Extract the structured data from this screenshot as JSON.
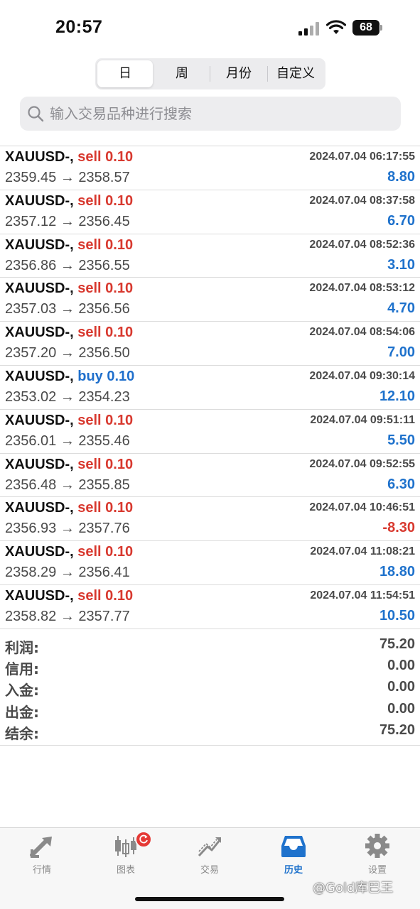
{
  "status_bar": {
    "time": "20:57",
    "battery": "68"
  },
  "period_tabs": [
    "日",
    "周",
    "月份",
    "自定义"
  ],
  "search": {
    "placeholder": "输入交易品种进行搜索"
  },
  "trades": [
    {
      "symbol": "XAUUSD-,",
      "side": "sell",
      "volume": "0.10",
      "time": "2024.07.04 06:17:55",
      "open": "2359.45",
      "close": "2358.57",
      "profit": "8.80"
    },
    {
      "symbol": "XAUUSD-,",
      "side": "sell",
      "volume": "0.10",
      "time": "2024.07.04 08:37:58",
      "open": "2357.12",
      "close": "2356.45",
      "profit": "6.70"
    },
    {
      "symbol": "XAUUSD-,",
      "side": "sell",
      "volume": "0.10",
      "time": "2024.07.04 08:52:36",
      "open": "2356.86",
      "close": "2356.55",
      "profit": "3.10"
    },
    {
      "symbol": "XAUUSD-,",
      "side": "sell",
      "volume": "0.10",
      "time": "2024.07.04 08:53:12",
      "open": "2357.03",
      "close": "2356.56",
      "profit": "4.70"
    },
    {
      "symbol": "XAUUSD-,",
      "side": "sell",
      "volume": "0.10",
      "time": "2024.07.04 08:54:06",
      "open": "2357.20",
      "close": "2356.50",
      "profit": "7.00"
    },
    {
      "symbol": "XAUUSD-,",
      "side": "buy",
      "volume": "0.10",
      "time": "2024.07.04 09:30:14",
      "open": "2353.02",
      "close": "2354.23",
      "profit": "12.10"
    },
    {
      "symbol": "XAUUSD-,",
      "side": "sell",
      "volume": "0.10",
      "time": "2024.07.04 09:51:11",
      "open": "2356.01",
      "close": "2355.46",
      "profit": "5.50"
    },
    {
      "symbol": "XAUUSD-,",
      "side": "sell",
      "volume": "0.10",
      "time": "2024.07.04 09:52:55",
      "open": "2356.48",
      "close": "2355.85",
      "profit": "6.30"
    },
    {
      "symbol": "XAUUSD-,",
      "side": "sell",
      "volume": "0.10",
      "time": "2024.07.04 10:46:51",
      "open": "2356.93",
      "close": "2357.76",
      "profit": "-8.30"
    },
    {
      "symbol": "XAUUSD-,",
      "side": "sell",
      "volume": "0.10",
      "time": "2024.07.04 11:08:21",
      "open": "2358.29",
      "close": "2356.41",
      "profit": "18.80"
    },
    {
      "symbol": "XAUUSD-,",
      "side": "sell",
      "volume": "0.10",
      "time": "2024.07.04 11:54:51",
      "open": "2358.82",
      "close": "2357.77",
      "profit": "10.50"
    }
  ],
  "summary": [
    {
      "label": "利润:",
      "value": "75.20"
    },
    {
      "label": "信用:",
      "value": "0.00"
    },
    {
      "label": "入金:",
      "value": "0.00"
    },
    {
      "label": "出金:",
      "value": "0.00"
    },
    {
      "label": "结余:",
      "value": "75.20"
    }
  ],
  "tab_bar": [
    {
      "label": "行情",
      "icon": "quotes-arrows-icon"
    },
    {
      "label": "图表",
      "icon": "candlestick-chart-icon"
    },
    {
      "label": "交易",
      "icon": "trade-trend-icon"
    },
    {
      "label": "历史",
      "icon": "history-inbox-icon"
    },
    {
      "label": "设置",
      "icon": "gear-icon"
    }
  ],
  "watermark": "@Gold库巴王",
  "colors": {
    "sell": "#d8392f",
    "buy": "#1f6fcc",
    "profit_positive": "#1f72cc",
    "profit_negative": "#d8392f",
    "active_tab": "#1f72cc"
  }
}
